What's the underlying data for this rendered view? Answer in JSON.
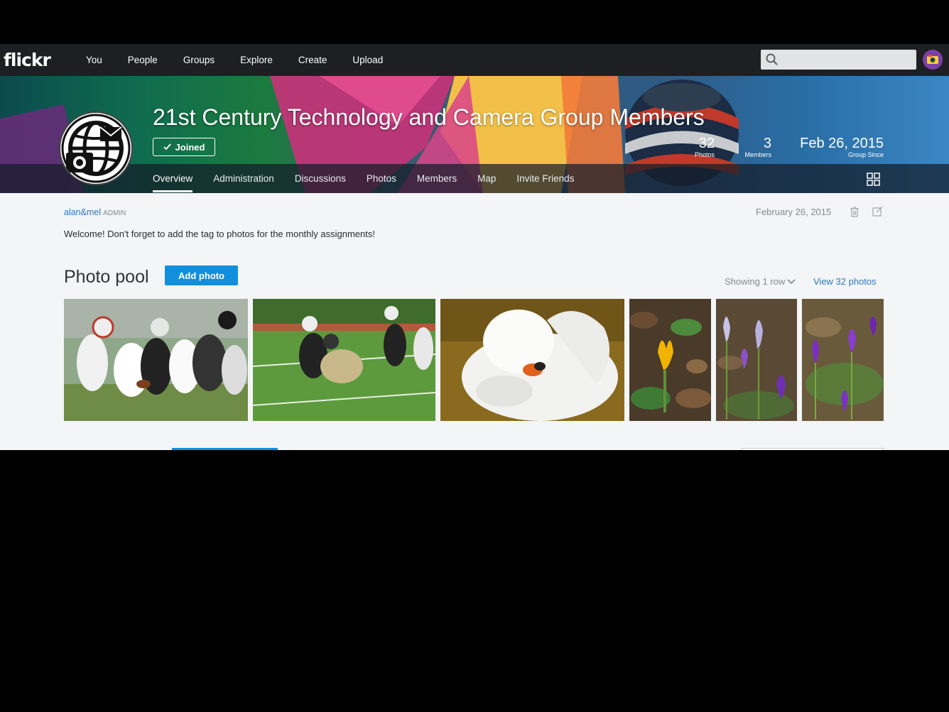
{
  "app": {
    "logo": "flickr",
    "nav": [
      "You",
      "People",
      "Groups",
      "Explore",
      "Create",
      "Upload"
    ],
    "search": {
      "placeholder": "",
      "value": ""
    }
  },
  "group": {
    "title": "21st Century Technology and Camera Group Members",
    "joined_label": "Joined",
    "stats": {
      "photos": {
        "value": "32",
        "label": "Photos"
      },
      "members": {
        "value": "3",
        "label": "Members"
      },
      "since": {
        "value": "Feb 26, 2015",
        "label": "Group Since"
      }
    },
    "tabs": [
      "Overview",
      "Administration",
      "Discussions",
      "Photos",
      "Members",
      "Map",
      "Invite Friends"
    ],
    "active_tab": "Overview"
  },
  "post": {
    "author": "alan&mel",
    "role": "ADMIN",
    "date": "February 26, 2015",
    "text": "Welcome! Don't forget to add the tag to photos for the monthly assignments!"
  },
  "pool": {
    "title": "Photo pool",
    "add_label": "Add photo",
    "showing_label": "Showing 1 row",
    "view_all_label": "View 32 photos",
    "photos": [
      {
        "subject": "american-football-tackle"
      },
      {
        "subject": "american-football-runner"
      },
      {
        "subject": "white-swan"
      },
      {
        "subject": "yellow-crocus"
      },
      {
        "subject": "pale-purple-crocus"
      },
      {
        "subject": "purple-crocus"
      }
    ]
  },
  "colors": {
    "accent": "#128fdc",
    "link": "#3277c3",
    "topbar": "#1e1f22",
    "content_bg": "#f3f5f6"
  }
}
